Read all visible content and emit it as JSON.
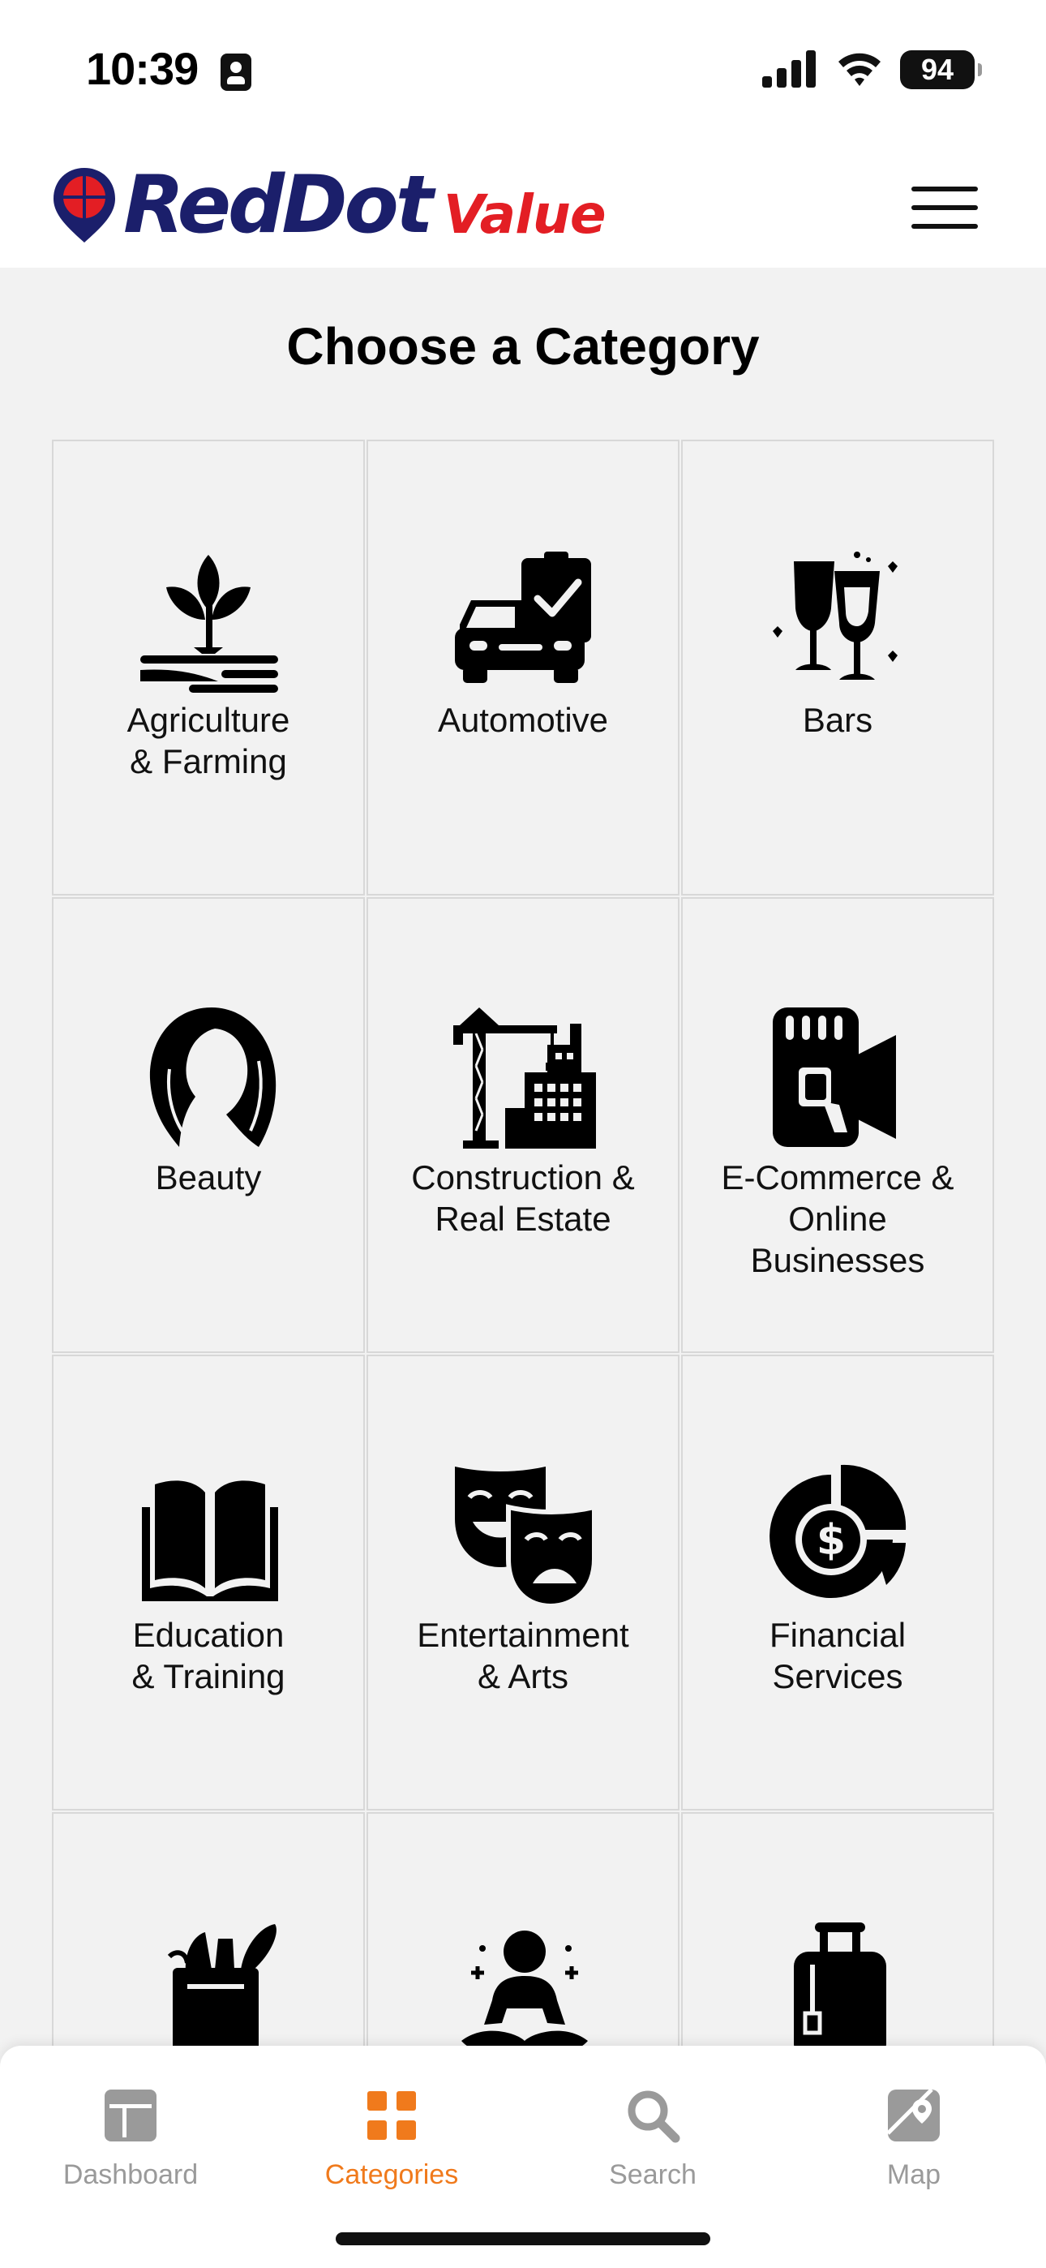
{
  "status_bar": {
    "time": "10:39",
    "battery": "94"
  },
  "header": {
    "logo_main": "RedDot",
    "logo_sub": "Value",
    "menu_icon": "hamburger-icon"
  },
  "page": {
    "title": "Choose a Category"
  },
  "categories": [
    {
      "label": "Agriculture\n& Farming",
      "icon": "plant-icon"
    },
    {
      "label": "Automotive",
      "icon": "car-checklist-icon"
    },
    {
      "label": "Bars",
      "icon": "wine-glasses-icon"
    },
    {
      "label": "Beauty",
      "icon": "woman-hair-icon"
    },
    {
      "label": "Construction &\nReal Estate",
      "icon": "crane-building-icon"
    },
    {
      "label": "E-Commerce &\nOnline\nBusinesses",
      "icon": "phone-megaphone-icon"
    },
    {
      "label": "Education\n& Training",
      "icon": "open-book-icon"
    },
    {
      "label": "Entertainment\n& Arts",
      "icon": "theater-masks-icon"
    },
    {
      "label": "Financial\nServices",
      "icon": "dollar-pie-chart-icon"
    },
    {
      "label": "",
      "icon": "grocery-bag-icon"
    },
    {
      "label": "",
      "icon": "meditation-icon"
    },
    {
      "label": "",
      "icon": "luggage-icon"
    }
  ],
  "tabs": [
    {
      "label": "Dashboard",
      "icon": "dashboard-icon",
      "active": false
    },
    {
      "label": "Categories",
      "icon": "grid-icon",
      "active": true
    },
    {
      "label": "Search",
      "icon": "search-icon",
      "active": false
    },
    {
      "label": "Map",
      "icon": "map-icon",
      "active": false
    }
  ],
  "colors": {
    "brand_navy": "#1b1f6b",
    "brand_red": "#e31e24",
    "active_tab": "#f07a1c",
    "inactive_tab": "#9a9a9a",
    "background": "#f2f2f2"
  }
}
